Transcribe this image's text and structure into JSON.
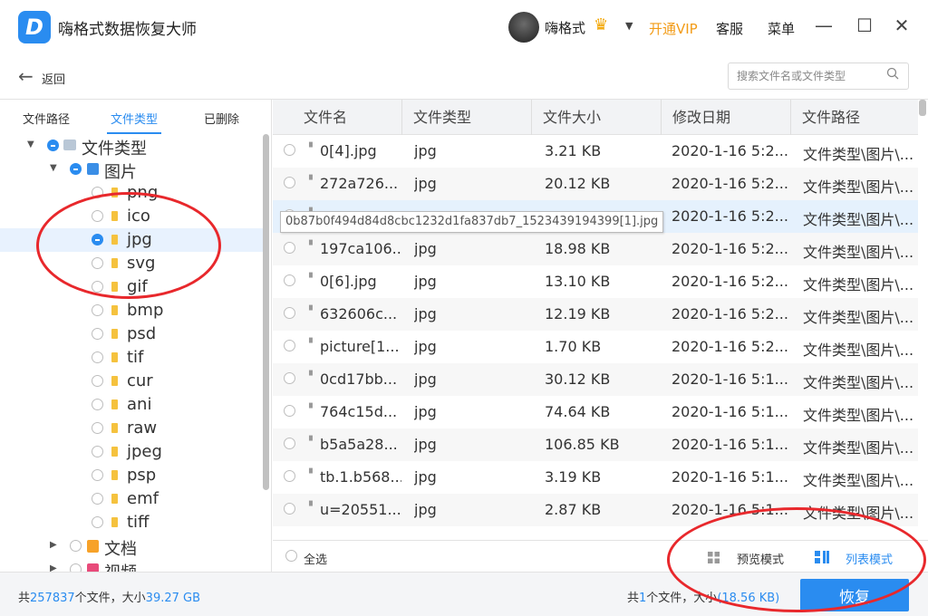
{
  "app": {
    "title": "嗨格式数据恢复大师",
    "username": "嗨格式",
    "vip_label": "开通VIP",
    "service_label": "客服",
    "menu_label": "菜单"
  },
  "toolbar": {
    "back_label": "返回",
    "search_placeholder": "搜索文件名或文件类型"
  },
  "sidebar": {
    "tabs": [
      "文件路径",
      "文件类型",
      "已删除"
    ],
    "active_tab": "文件类型",
    "tree": {
      "root": "文件类型",
      "images": "图片",
      "image_types": [
        "png",
        "ico",
        "jpg",
        "svg",
        "gif",
        "bmp",
        "psd",
        "tif",
        "cur",
        "ani",
        "raw",
        "jpeg",
        "psp",
        "emf",
        "tiff"
      ],
      "selected_type": "jpg",
      "documents": "文档",
      "videos": "视频"
    }
  },
  "table": {
    "columns": [
      "文件名",
      "文件类型",
      "文件大小",
      "修改日期",
      "文件路径"
    ],
    "rows": [
      {
        "name": "0[4].jpg",
        "type": "jpg",
        "size": "3.21 KB",
        "date": "2020-1-16 5:2...",
        "path": "文件类型\\图片\\..."
      },
      {
        "name": "272a726...",
        "type": "jpg",
        "size": "20.12 KB",
        "date": "2020-1-16 5:2...",
        "path": "文件类型\\图片\\..."
      },
      {
        "name": "",
        "type": "",
        "size": "",
        "date": "2020-1-16 5:2...",
        "path": "文件类型\\图片\\..."
      },
      {
        "name": "197ca106...",
        "type": "jpg",
        "size": "18.98 KB",
        "date": "2020-1-16 5:2...",
        "path": "文件类型\\图片\\..."
      },
      {
        "name": "0[6].jpg",
        "type": "jpg",
        "size": "13.10 KB",
        "date": "2020-1-16 5:2...",
        "path": "文件类型\\图片\\..."
      },
      {
        "name": "632606c...",
        "type": "jpg",
        "size": "12.19 KB",
        "date": "2020-1-16 5:2...",
        "path": "文件类型\\图片\\..."
      },
      {
        "name": "picture[1...",
        "type": "jpg",
        "size": "1.70 KB",
        "date": "2020-1-16 5:2...",
        "path": "文件类型\\图片\\..."
      },
      {
        "name": "0cd17bb...",
        "type": "jpg",
        "size": "30.12 KB",
        "date": "2020-1-16 5:1...",
        "path": "文件类型\\图片\\..."
      },
      {
        "name": "764c15d...",
        "type": "jpg",
        "size": "74.64 KB",
        "date": "2020-1-16 5:1...",
        "path": "文件类型\\图片\\..."
      },
      {
        "name": "b5a5a28...",
        "type": "jpg",
        "size": "106.85 KB",
        "date": "2020-1-16 5:1...",
        "path": "文件类型\\图片\\..."
      },
      {
        "name": "tb.1.b568...",
        "type": "jpg",
        "size": "3.19 KB",
        "date": "2020-1-16 5:1...",
        "path": "文件类型\\图片\\..."
      },
      {
        "name": "u=20551...",
        "type": "jpg",
        "size": "2.87 KB",
        "date": "2020-1-16 5:1...",
        "path": "文件类型\\图片\\..."
      }
    ],
    "tooltip": "0b87b0f494d84d8cbc1232d1fa837db7_1523439194399[1].jpg"
  },
  "bottom": {
    "select_all": "全选",
    "preview_mode": "预览模式",
    "list_mode": "列表模式"
  },
  "status": {
    "total_prefix": "共",
    "total_files": "257837",
    "total_mid": "个文件，大小",
    "total_size": "39.27 GB",
    "sel_prefix": "共",
    "sel_count": "1",
    "sel_mid": "个文件，大小",
    "sel_size": "(18.56 KB)",
    "recover_label": "恢复"
  },
  "colors": {
    "accent": "#2a8cf0",
    "vip": "#f29b16",
    "annotation": "#e8282c"
  }
}
